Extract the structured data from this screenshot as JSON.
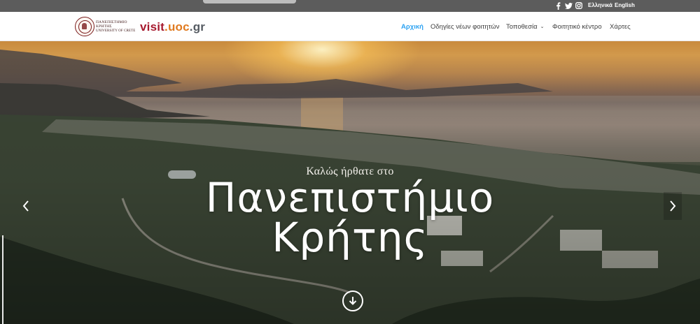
{
  "topbar": {
    "social": [
      {
        "name": "facebook-icon"
      },
      {
        "name": "twitter-icon"
      },
      {
        "name": "instagram-icon"
      }
    ],
    "languages": [
      "Ελληνικά",
      "English"
    ]
  },
  "header": {
    "logo_line1": "ΠΑΝΕΠΙΣΤΗΜΙΟ ΚΡΗΤΗΣ",
    "logo_line2": "UNIVERSITY OF CRETE",
    "brand": {
      "part1": "visit",
      "part2": ".uoc",
      "part3": ".gr"
    },
    "brand_colors": {
      "red": "#a6192e",
      "orange": "#e07a1f",
      "gray": "#555b62"
    },
    "nav": [
      {
        "label": "Αρχική",
        "active": true
      },
      {
        "label": "Οδηγίες νέων φοιτητών",
        "active": false
      },
      {
        "label": "Τοποθεσία",
        "active": false,
        "has_dropdown": true
      },
      {
        "label": "Φοιτητικό κέντρο",
        "active": false
      },
      {
        "label": "Χάρτες",
        "active": false
      }
    ],
    "accent_color": "#2ea3f2"
  },
  "hero": {
    "welcome": "Καλώς ήρθατε στο",
    "title_line1": "Πανεπιστήμιο",
    "title_line2": "Κρήτης",
    "prev_icon": "chevron-left-icon",
    "next_icon": "chevron-right-icon",
    "scroll_icon": "arrow-down-circle-icon"
  }
}
